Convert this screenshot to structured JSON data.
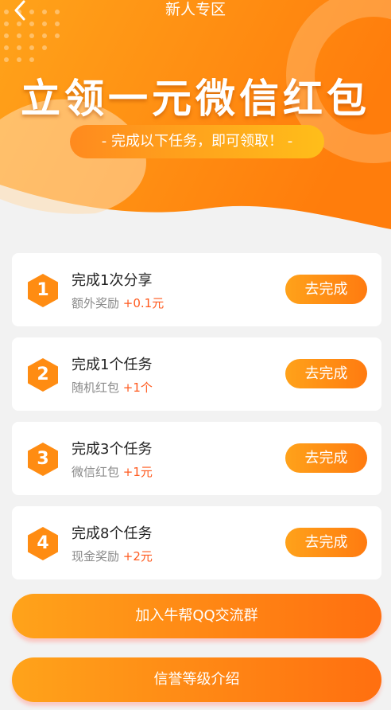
{
  "header": {
    "back_icon": "chevron-left-icon",
    "title": "新人专区"
  },
  "banner": {
    "headline": "立领一元微信红包",
    "subtitle": "- 完成以下任务，即可领取！ -"
  },
  "tasks": [
    {
      "number": "1",
      "title": "完成1次分享",
      "desc": "额外奖励",
      "reward": "+0.1元",
      "button": "去完成"
    },
    {
      "number": "2",
      "title": "完成1个任务",
      "desc": "随机红包",
      "reward": "+1个",
      "button": "去完成"
    },
    {
      "number": "3",
      "title": "完成3个任务",
      "desc": "微信红包",
      "reward": "+1元",
      "button": "去完成"
    },
    {
      "number": "4",
      "title": "完成8个任务",
      "desc": "现金奖励",
      "reward": "+2元",
      "button": "去完成"
    }
  ],
  "actions": {
    "join_group": "加入牛帮QQ交流群",
    "credit_intro": "信誉等级介绍"
  },
  "colors": {
    "primary": "#ff8a10",
    "accent_start": "#ffa21a",
    "accent_end": "#ff6f10",
    "reward": "#ff5a1e",
    "background": "#f2f2f2"
  }
}
